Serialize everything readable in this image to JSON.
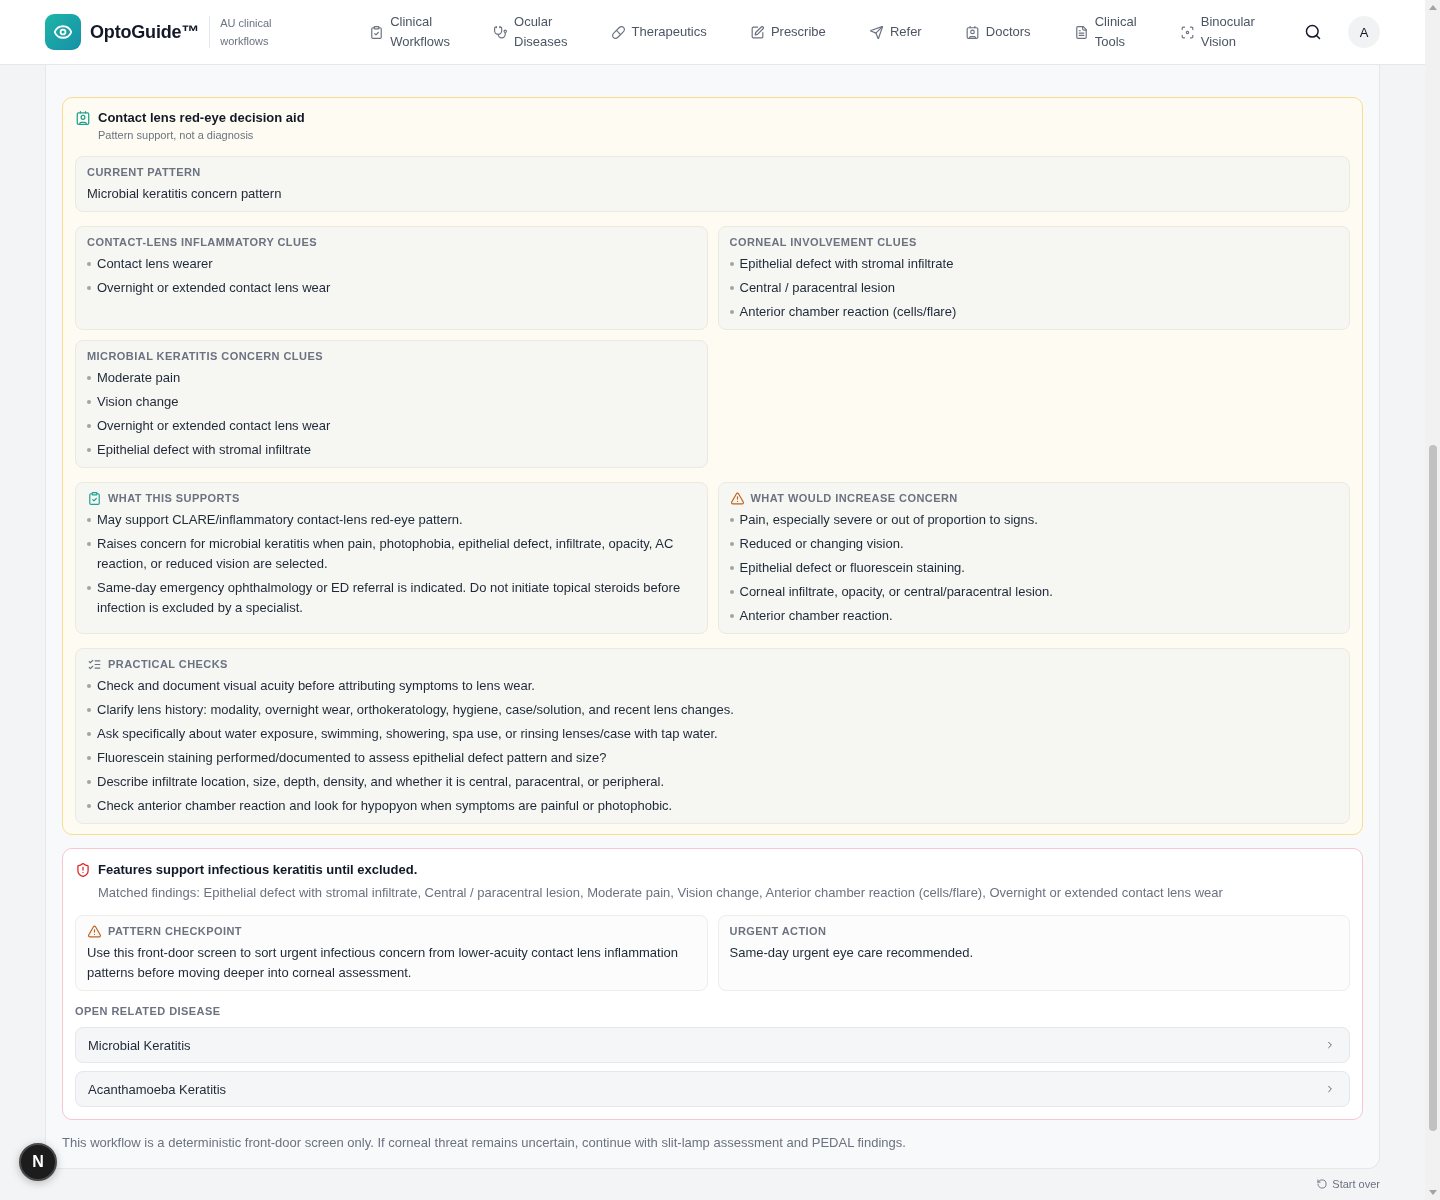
{
  "header": {
    "app_name": "OptoGuide™",
    "tagline": "AU clinical workflows",
    "nav": [
      "Clinical Workflows",
      "Ocular Diseases",
      "Therapeutics",
      "Prescribe",
      "Refer",
      "Doctors",
      "Clinical Tools",
      "Binocular Vision"
    ],
    "avatar": "A"
  },
  "decision_aid": {
    "title": "Contact lens red-eye decision aid",
    "subtitle": "Pattern support, not a diagnosis",
    "current_pattern": {
      "label": "CURRENT PATTERN",
      "value": "Microbial keratitis concern pattern"
    },
    "clue_groups": [
      {
        "label": "CONTACT-LENS INFLAMMATORY CLUES",
        "items": [
          "Contact lens wearer",
          "Overnight or extended contact lens wear"
        ]
      },
      {
        "label": "CORNEAL INVOLVEMENT CLUES",
        "items": [
          "Epithelial defect with stromal infiltrate",
          "Central / paracentral lesion",
          "Anterior chamber reaction (cells/flare)"
        ]
      },
      {
        "label": "MICROBIAL KERATITIS CONCERN CLUES",
        "items": [
          "Moderate pain",
          "Vision change",
          "Overnight or extended contact lens wear",
          "Epithelial defect with stromal infiltrate"
        ]
      }
    ],
    "guidance": [
      {
        "kind": "supports",
        "label": "WHAT THIS SUPPORTS",
        "items": [
          "May support CLARE/inflammatory contact-lens red-eye pattern.",
          "Raises concern for microbial keratitis when pain, photophobia, epithelial defect, infiltrate, opacity, AC reaction, or reduced vision are selected.",
          "Same-day emergency ophthalmology or ED referral is indicated. Do not initiate topical steroids before infection is excluded by a specialist."
        ]
      },
      {
        "kind": "concern",
        "label": "WHAT WOULD INCREASE CONCERN",
        "items": [
          "Pain, especially severe or out of proportion to signs.",
          "Reduced or changing vision.",
          "Epithelial defect or fluorescein staining.",
          "Corneal infiltrate, opacity, or central/paracentral lesion.",
          "Anterior chamber reaction."
        ]
      }
    ],
    "practical_checks": {
      "label": "PRACTICAL CHECKS",
      "items": [
        "Check and document visual acuity before attributing symptoms to lens wear.",
        "Clarify lens history: modality, overnight wear, orthokeratology, hygiene, case/solution, and recent lens changes.",
        "Ask specifically about water exposure, swimming, showering, spa use, or rinsing lenses/case with tap water.",
        "Fluorescein staining performed/documented to assess epithelial defect pattern and size?",
        "Describe infiltrate location, size, depth, density, and whether it is central, paracentral, or peripheral.",
        "Check anterior chamber reaction and look for hypopyon when symptoms are painful or photophobic."
      ]
    }
  },
  "alert": {
    "title": "Features support infectious keratitis until excluded.",
    "matched_findings": "Matched findings: Epithelial defect with stromal infiltrate, Central / paracentral lesion, Moderate pain, Vision change, Anterior chamber reaction (cells/flare), Overnight or extended contact lens wear",
    "panels": [
      {
        "kind": "caution",
        "label": "PATTERN CHECKPOINT",
        "text": "Use this front-door screen to sort urgent infectious concern from lower-acuity contact lens inflammation patterns before moving deeper into corneal assessment."
      },
      {
        "kind": "action",
        "label": "URGENT ACTION",
        "text": "Same-day urgent eye care recommended."
      }
    ],
    "related": {
      "label": "OPEN RELATED DISEASE",
      "links": [
        "Microbial Keratitis",
        "Acanthamoeba Keratitis"
      ]
    }
  },
  "footer_note": "This workflow is a deterministic front-door screen only. If corneal threat remains uncertain, continue with slit-lamp assessment and PEDAL findings.",
  "start_over": "Start over",
  "dev_badge": "N"
}
